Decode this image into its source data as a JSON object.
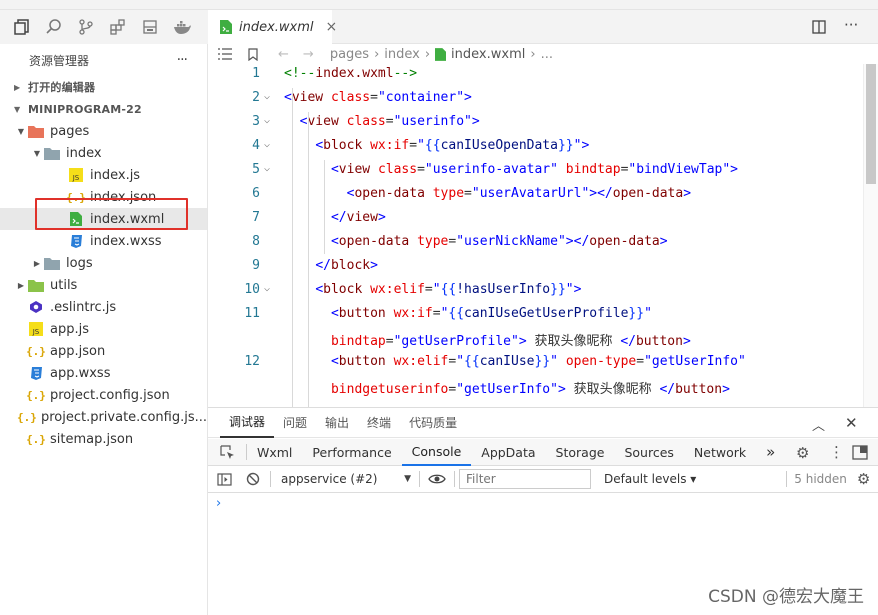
{
  "sidebar": {
    "title": "资源管理器",
    "more": "···",
    "open_editors": "打开的编辑器",
    "project": "MINIPROGRAM-22",
    "tree": [
      {
        "label": "pages",
        "icon": "folder-pages-icon",
        "depth": 1,
        "twisty": "▼"
      },
      {
        "label": "index",
        "icon": "folder-index-icon",
        "depth": 2,
        "twisty": "▼"
      },
      {
        "label": "index.js",
        "icon": "js-file-icon",
        "depth": 3,
        "twisty": ""
      },
      {
        "label": "index.json",
        "icon": "json-file-icon",
        "depth": 3,
        "twisty": ""
      },
      {
        "label": "index.wxml",
        "icon": "wxml-file-icon",
        "depth": 3,
        "twisty": ""
      },
      {
        "label": "index.wxss",
        "icon": "wxss-file-icon",
        "depth": 3,
        "twisty": ""
      },
      {
        "label": "logs",
        "icon": "folder-icon",
        "depth": 2,
        "twisty": "▶"
      },
      {
        "label": "utils",
        "icon": "folder-utils-icon",
        "depth": 1,
        "twisty": "▶"
      },
      {
        "label": ".eslintrc.js",
        "icon": "eslint-file-icon",
        "depth": 1,
        "twisty": ""
      },
      {
        "label": "app.js",
        "icon": "js-file-icon",
        "depth": 1,
        "twisty": ""
      },
      {
        "label": "app.json",
        "icon": "json-file-icon",
        "depth": 1,
        "twisty": ""
      },
      {
        "label": "app.wxss",
        "icon": "wxss-file-icon",
        "depth": 1,
        "twisty": ""
      },
      {
        "label": "project.config.json",
        "icon": "json-file-icon",
        "depth": 1,
        "twisty": ""
      },
      {
        "label": "project.private.config.js...",
        "icon": "json-file-icon",
        "depth": 1,
        "twisty": ""
      },
      {
        "label": "sitemap.json",
        "icon": "json-file-icon",
        "depth": 1,
        "twisty": ""
      }
    ],
    "selected": "index.wxml"
  },
  "editor": {
    "tab_label": "index.wxml",
    "tab_close": "×",
    "breadcrumb": [
      "pages",
      "index",
      "index.wxml",
      "..."
    ],
    "line_numbers": [
      "1",
      "2",
      "3",
      "4",
      "5",
      "6",
      "7",
      "8",
      "9",
      "10",
      "11",
      "",
      "12",
      ""
    ],
    "code_lines": [
      "<!--index.wxml-->",
      "<view class=\"container\">",
      "  <view class=\"userinfo\">",
      "    <block wx:if=\"{{canIUseOpenData}}\">",
      "      <view class=\"userinfo-avatar\" bindtap=\"bindViewTap\">",
      "        <open-data type=\"userAvatarUrl\"></open-data>",
      "      </view>",
      "      <open-data type=\"userNickName\"></open-data>",
      "    </block>",
      "    <block wx:elif=\"{{!hasUserInfo}}\">",
      "      <button wx:if=\"{{canIUseGetUserProfile}}\"",
      "      bindtap=\"getUserProfile\"> 获取头像昵称 </button>",
      "      <button wx:elif=\"{{canIUse}}\" open-type=\"getUserInfo\"",
      "      bindgetuserinfo=\"getUserInfo\"> 获取头像昵称 </button>"
    ]
  },
  "devtools": {
    "top_tabs": [
      "调试器",
      "问题",
      "输出",
      "终端",
      "代码质量"
    ],
    "panel_tabs": [
      "Wxml",
      "Performance",
      "Console",
      "AppData",
      "Storage",
      "Sources",
      "Network"
    ],
    "more_tabs": "»",
    "active_panel": "Console",
    "context": "appservice (#2)",
    "filter_placeholder": "Filter",
    "levels": "Default levels ▾",
    "hidden": "5 hidden",
    "prompt": "›"
  },
  "watermark": "CSDN @德宏大魔王"
}
